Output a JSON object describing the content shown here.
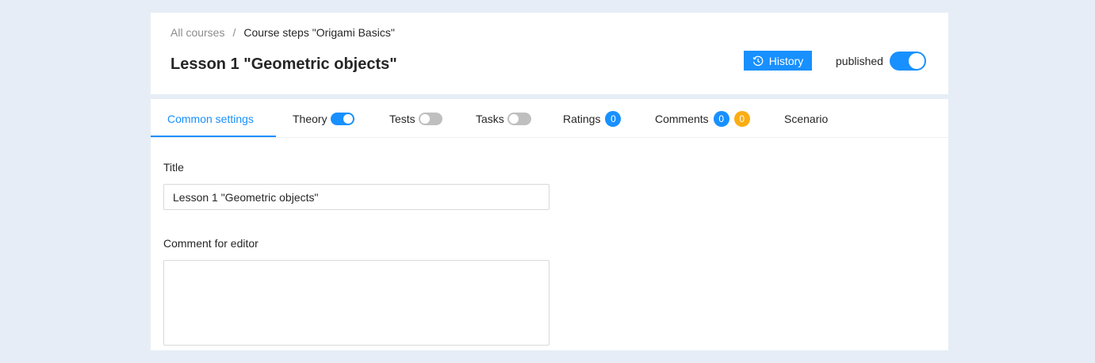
{
  "breadcrumb": {
    "root": "All courses",
    "separator": "/",
    "current": "Course steps \"Origami Basics\""
  },
  "page": {
    "title": "Lesson 1 \"Geometric objects\""
  },
  "header_actions": {
    "history_label": "History",
    "history_icon": "history-clock-icon",
    "published_label": "published",
    "published_on": true
  },
  "tabs": [
    {
      "label": "Common settings",
      "active": true
    },
    {
      "label": "Theory",
      "toggle_on": true
    },
    {
      "label": "Tests",
      "toggle_on": false
    },
    {
      "label": "Tasks",
      "toggle_on": false
    },
    {
      "label": "Ratings",
      "badges": [
        "0"
      ]
    },
    {
      "label": "Comments",
      "badges": [
        "0",
        "0"
      ]
    },
    {
      "label": "Scenario"
    }
  ],
  "form": {
    "title_label": "Title",
    "title_value": "Lesson 1 \"Geometric objects\"",
    "comment_label": "Comment for editor",
    "comment_value": ""
  },
  "colors": {
    "accent": "#1890ff",
    "badge_gold": "#faad14",
    "background": "#e6edf6"
  }
}
